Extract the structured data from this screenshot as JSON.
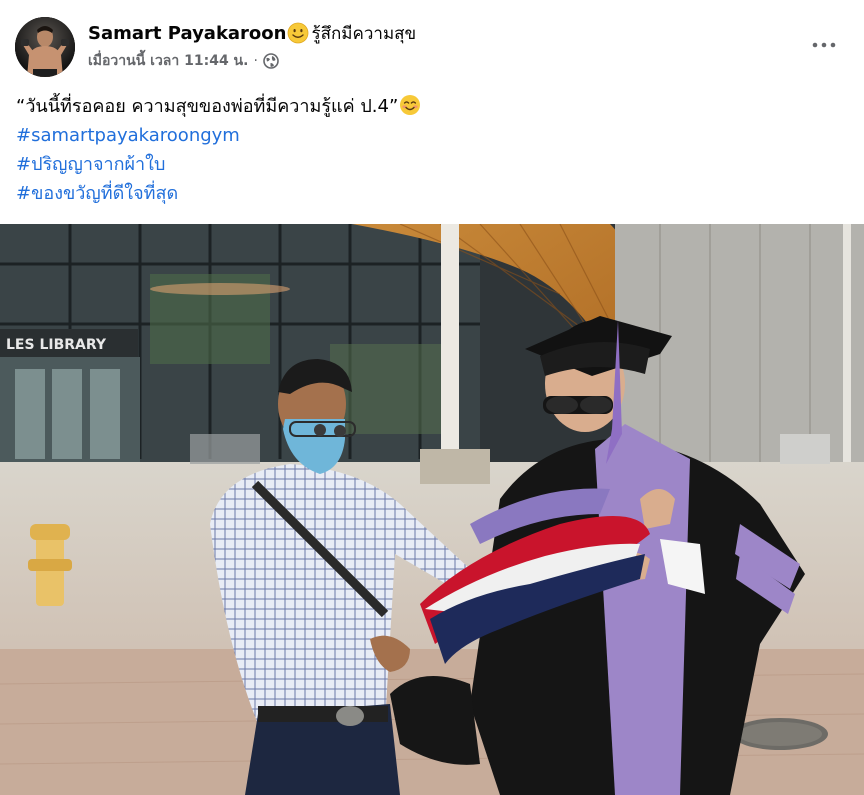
{
  "post": {
    "author_name": "Samart Payakaroon",
    "feeling_emoji": "smiling-face-emoji",
    "feeling_text": "รู้สึกมีความสุข",
    "timestamp": "เมื่อวานนี้ เวลา 11:44 น.",
    "separator": "·",
    "privacy_icon": "globe-icon",
    "more_icon": "more-options-icon",
    "caption": {
      "quote": "“วันนี้ที่รอคอย ความสุขของพ่อที่มีความรู้แค่ ป.4”",
      "quote_emoji": "smiling-face-with-smiling-eyes-emoji",
      "hashtags": [
        "#samartpayakaroongym",
        "#ปริญญาจากผ้าใบ",
        "#ของขวัญที่ดีใจที่สุด"
      ]
    },
    "photo": {
      "sign_text": "LES LIBRARY"
    }
  },
  "colors": {
    "text_primary": "#050505",
    "text_secondary": "#65676b",
    "hashtag": "#216fdb",
    "gown_purple": "#9d86c8",
    "gown_black": "#151515"
  }
}
